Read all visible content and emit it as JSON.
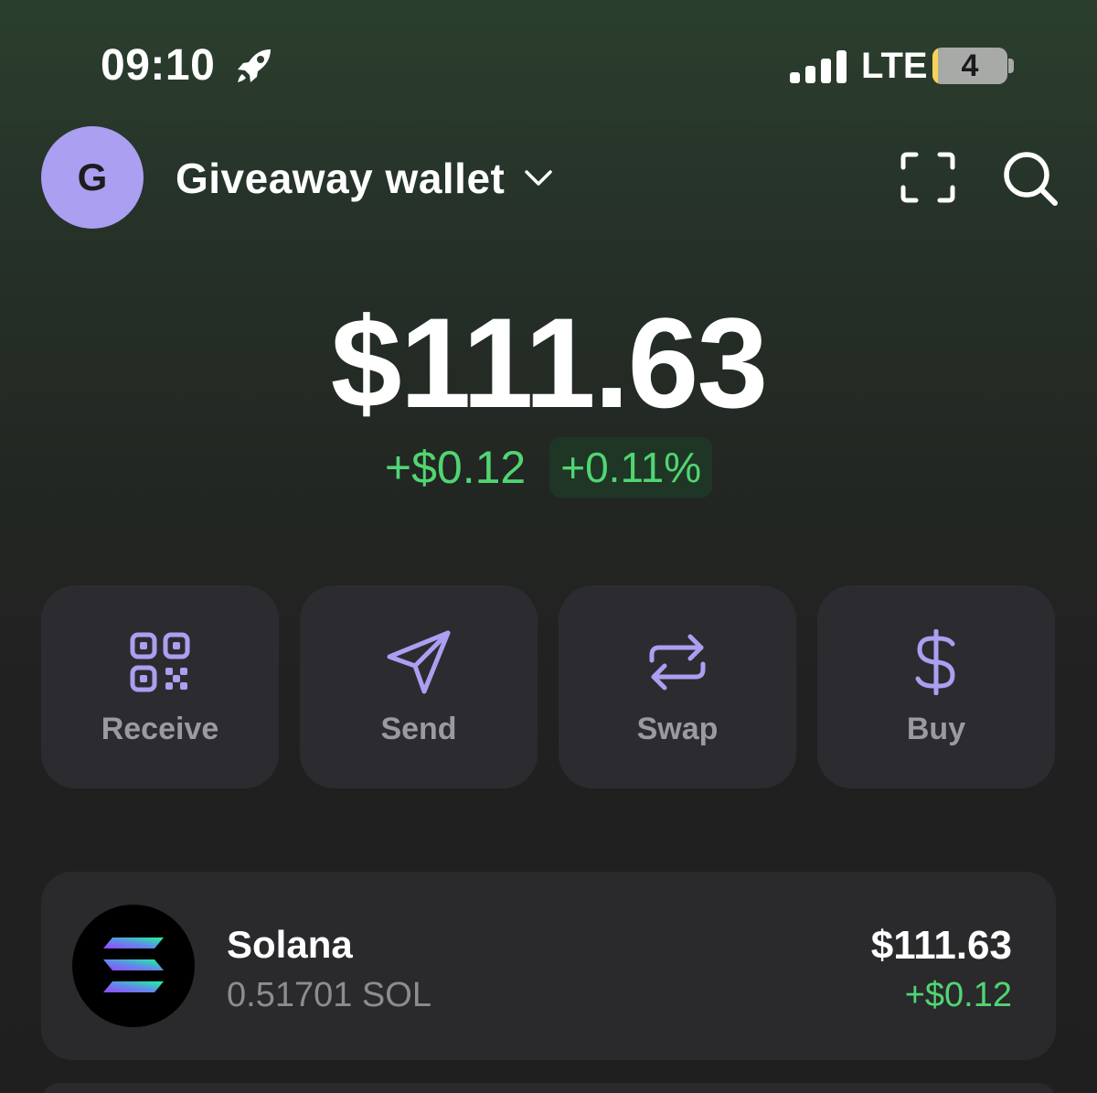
{
  "status_bar": {
    "time": "09:10",
    "network": "LTE",
    "battery_level": "4",
    "icons": [
      "rocket-icon",
      "signal-icon",
      "battery-icon"
    ]
  },
  "header": {
    "avatar_letter": "G",
    "wallet_name": "Giveaway wallet",
    "icons": [
      "chevron-down-icon",
      "scan-icon",
      "search-icon"
    ]
  },
  "balance": {
    "total": "$111.63",
    "change_abs": "+$0.12",
    "change_pct": "+0.11%"
  },
  "actions": [
    {
      "label": "Receive",
      "icon": "qr-code-icon"
    },
    {
      "label": "Send",
      "icon": "send-icon"
    },
    {
      "label": "Swap",
      "icon": "swap-icon"
    },
    {
      "label": "Buy",
      "icon": "dollar-icon"
    }
  ],
  "tokens": [
    {
      "name": "Solana",
      "amount": "0.51701 SOL",
      "value": "$111.63",
      "change": "+$0.12",
      "icon": "solana-logo-icon"
    }
  ],
  "colors": {
    "accent": "#ab9ff2",
    "positive": "#51d572",
    "card": "#2c2c30",
    "text": "#ffffff",
    "muted": "#8d8d91"
  }
}
